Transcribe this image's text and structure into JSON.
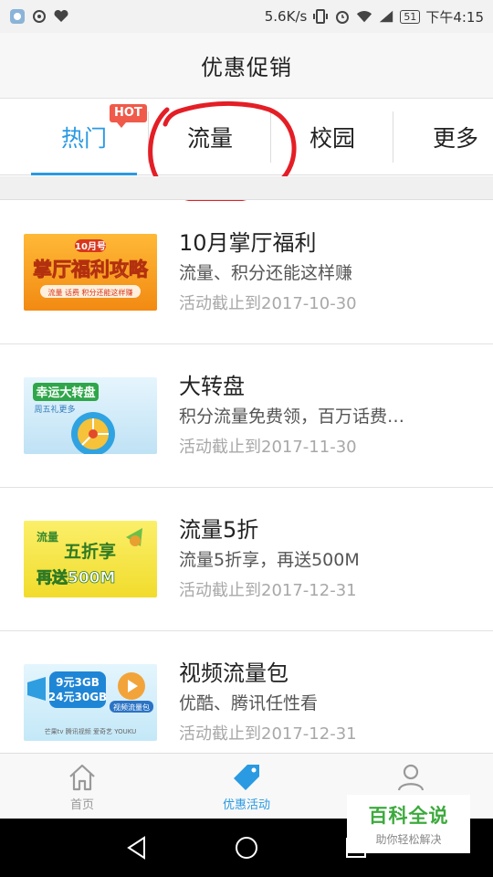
{
  "status_bar": {
    "speed": "5.6K/s",
    "signal_label": "4G",
    "battery": "51",
    "time": "下午4:15"
  },
  "header": {
    "title": "优惠促销"
  },
  "tabs": [
    {
      "label": "热门",
      "badge": "HOT",
      "active": true
    },
    {
      "label": "流量",
      "active": false
    },
    {
      "label": "校园",
      "active": false
    },
    {
      "label": "更多",
      "active": false
    }
  ],
  "promotions": [
    {
      "title": "10月掌厅福利",
      "description": "流量、积分还能这样赚",
      "date": "活动截止到2017-10-30",
      "thumb": {
        "line1": "10月号",
        "line2": "掌厅福利攻略",
        "line3": "流量 话费 积分还能这样赚",
        "bg": "#f5a021"
      }
    },
    {
      "title": "大转盘",
      "description": "积分流量免费领，百万话费…",
      "date": "活动截止到2017-11-30",
      "thumb": {
        "line1": "幸运大转盘",
        "line2": "周五礼更多",
        "bg": "#cfe9f7"
      }
    },
    {
      "title": "流量5折",
      "description": "流量5折享，再送500M",
      "date": "活动截止到2017-12-31",
      "thumb": {
        "line1": "流量",
        "line2": "五折享",
        "line3": "再送500M",
        "bg": "#f7e84a"
      }
    },
    {
      "title": "视频流量包",
      "description": "优酷、腾讯任性看",
      "date": "活动截止到2017-12-31",
      "thumb": {
        "line1": "9元3GB",
        "line2": "24元30GB",
        "line3": "视频流量包",
        "line4": "芒果tv  腾讯视频  爱奇艺  YOUKU",
        "bg": "#d7f0fb"
      }
    }
  ],
  "bottom_nav": [
    {
      "label": "首页",
      "icon": "home-icon",
      "active": false
    },
    {
      "label": "优惠活动",
      "icon": "tag-icon",
      "active": true
    },
    {
      "label": "",
      "icon": "user-icon",
      "active": false
    }
  ],
  "watermark": {
    "title": "百科全说",
    "subtitle": "助你轻松解决"
  },
  "colors": {
    "accent": "#2a9ae2",
    "hot_badge": "#f05a4a",
    "annotation": "#e41e26"
  }
}
